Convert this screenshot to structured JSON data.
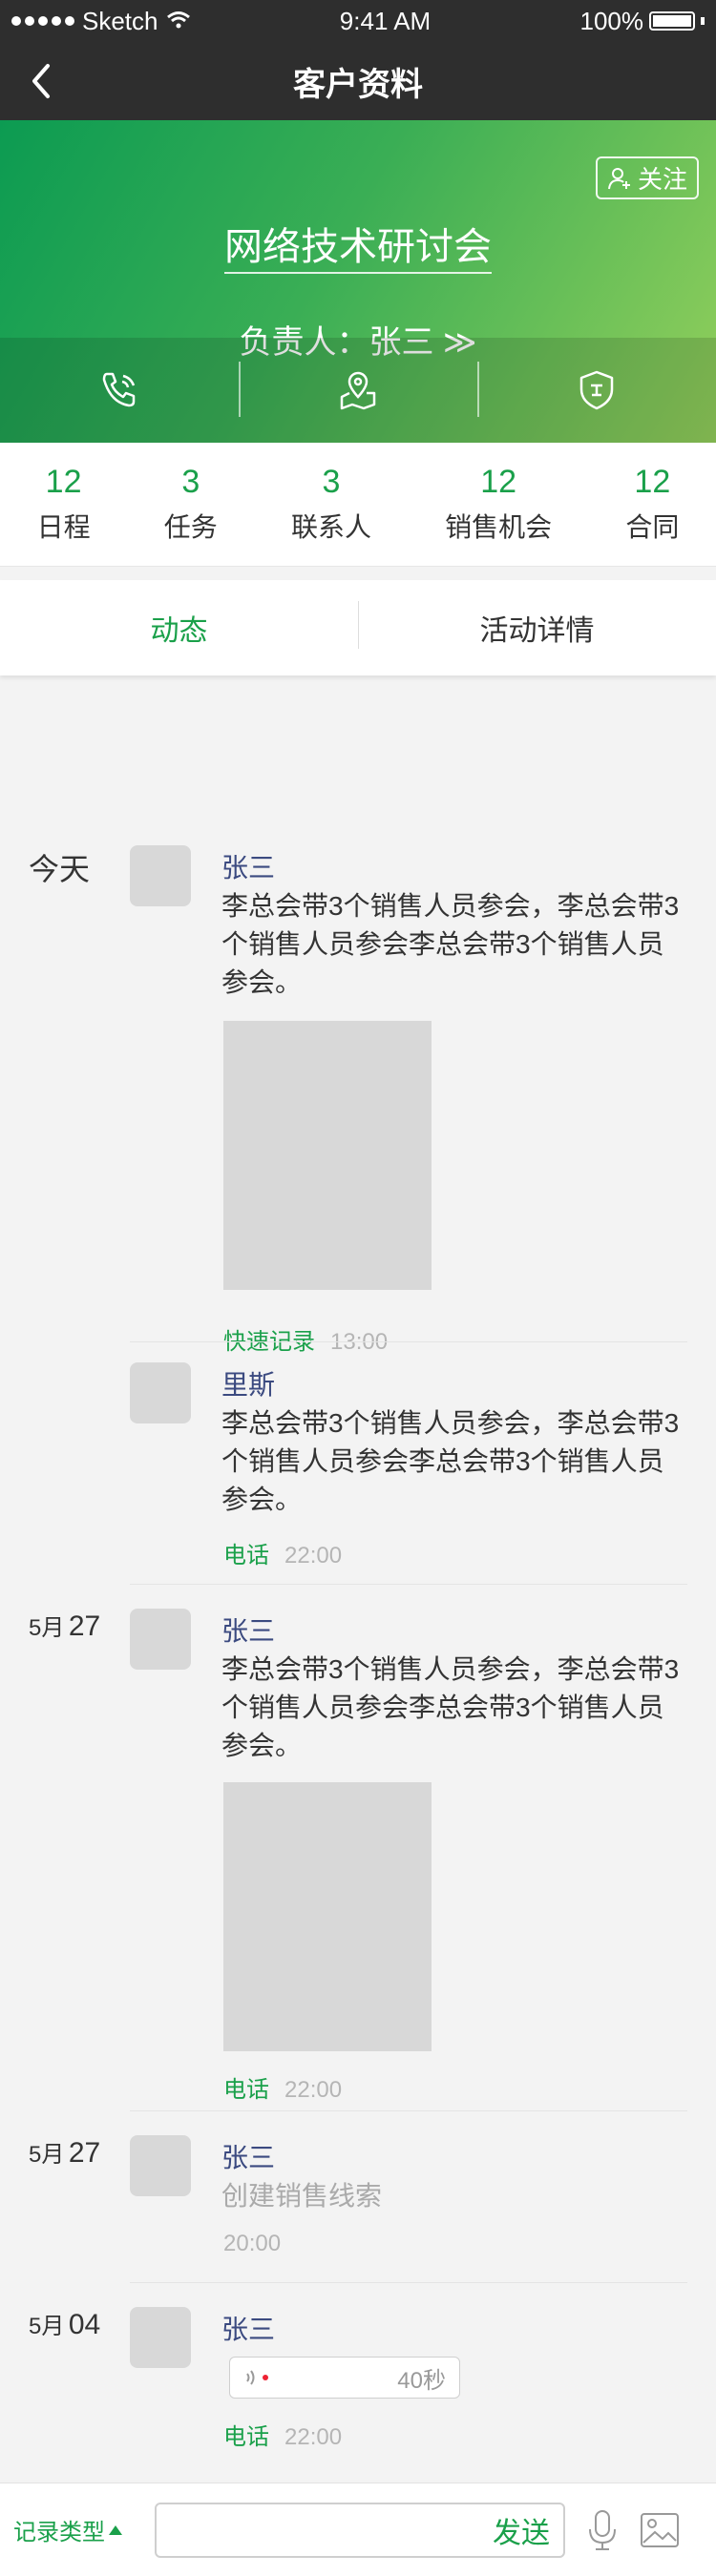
{
  "status": {
    "carrier": "Sketch",
    "time": "9:41 AM",
    "battery": "100%"
  },
  "nav": {
    "title": "客户资料"
  },
  "hero": {
    "follow_label": "关注",
    "title": "网络技术研讨会",
    "owner": "负责人：张三 ≫"
  },
  "stats": [
    {
      "num": "12",
      "label": "日程"
    },
    {
      "num": "3",
      "label": "任务"
    },
    {
      "num": "3",
      "label": "联系人"
    },
    {
      "num": "12",
      "label": "销售机会"
    },
    {
      "num": "12",
      "label": "合同"
    }
  ],
  "tabs": [
    {
      "label": "动态",
      "active": true
    },
    {
      "label": "活动详情",
      "active": false
    }
  ],
  "timeline": [
    {
      "date_today": "今天",
      "name": "张三",
      "text": "李总会带3个销售人员参会，李总会带3个销售人员参会李总会带3个销售人员参会。",
      "type": "快速记录",
      "time": "13:00"
    },
    {
      "name": "里斯",
      "text": "李总会带3个销售人员参会，李总会带3个销售人员参会李总会带3个销售人员参会。",
      "type": "电话",
      "time": "22:00"
    },
    {
      "month": "5月",
      "day": "27",
      "name": "张三",
      "text": "李总会带3个销售人员参会，李总会带3个销售人员参会李总会带3个销售人员参会。",
      "type": "电话",
      "time": "22:00"
    },
    {
      "month": "5月",
      "day": "27",
      "name": "张三",
      "text": "创建销售线索",
      "time": "20:00"
    },
    {
      "month": "5月",
      "day": "04",
      "name": "张三",
      "voice_duration": "40秒",
      "type": "电话",
      "time": "22:00"
    }
  ],
  "bottom": {
    "record_type": "记录类型",
    "send": "发送"
  },
  "colors": {
    "accent": "#1aa04a",
    "name": "#3b4a80"
  }
}
